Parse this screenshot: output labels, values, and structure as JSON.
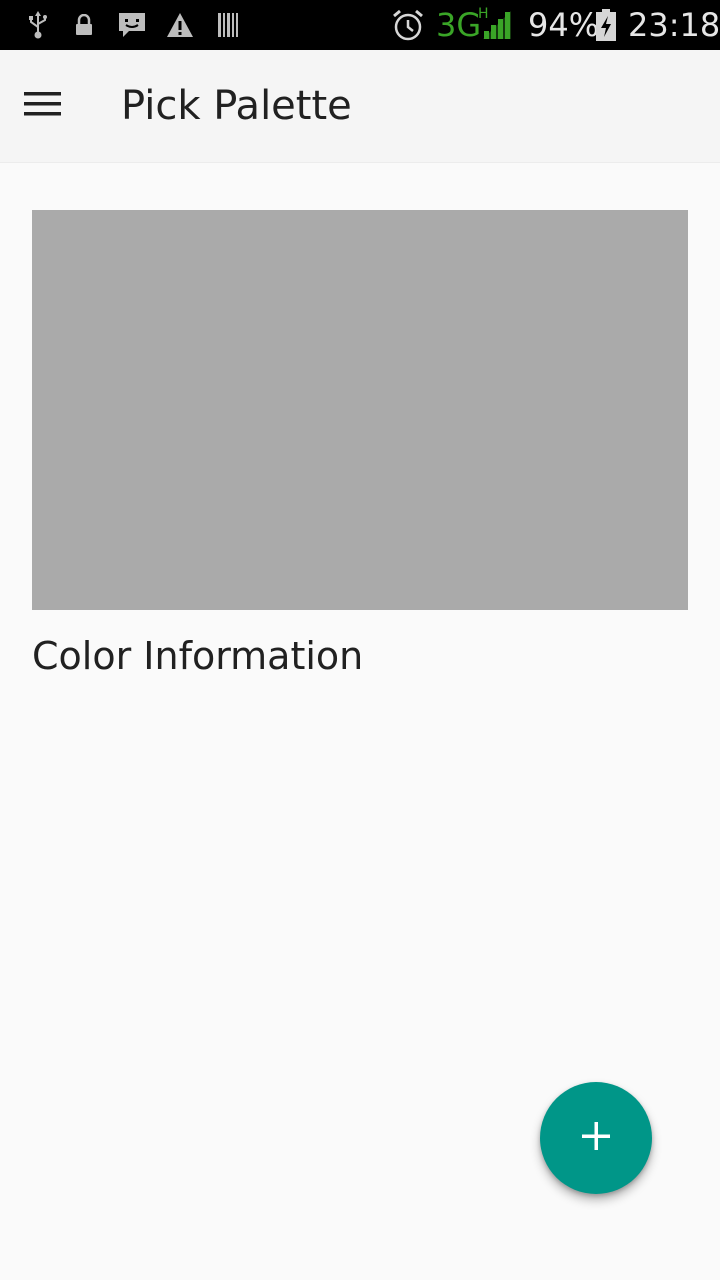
{
  "status_bar": {
    "network_type": "3G",
    "network_sub": "H",
    "battery": "94%",
    "time": "23:18",
    "network_color": "#3aa527",
    "icons": [
      "usb-icon",
      "lock-icon",
      "message-icon",
      "warning-icon",
      "barcode-icon",
      "alarm-icon",
      "signal-icon",
      "battery-charging-icon"
    ]
  },
  "app_bar": {
    "title": "Pick Palette",
    "menu_icon": "hamburger-menu-icon",
    "background": "#f5f5f5"
  },
  "main": {
    "preview_color": "#aaaaaa",
    "color_info_label": "Color Information"
  },
  "fab": {
    "icon": "plus-icon",
    "color": "#009688"
  }
}
